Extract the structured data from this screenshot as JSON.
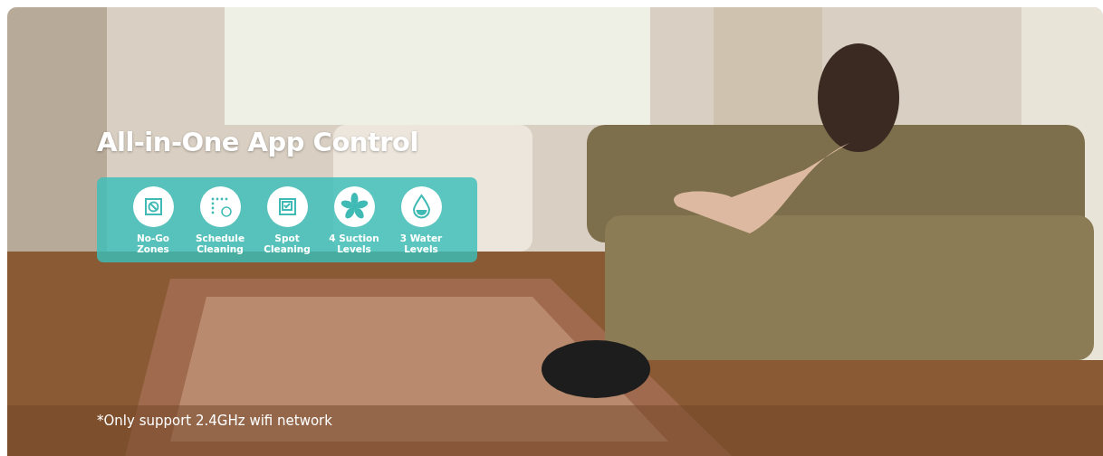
{
  "banner": {
    "kind": "picture",
    "title": "All-in-One App Control",
    "features": [
      {
        "kind": "zone",
        "label": "No-Go Zones"
      },
      {
        "kind": "schedule",
        "label": "Schedule Cleaning"
      },
      {
        "kind": "spot",
        "label": "Spot Cleaning"
      },
      {
        "kind": "suction",
        "label": "4 Suction Levels"
      },
      {
        "kind": "water",
        "label": "3 Water Levels"
      }
    ],
    "footnote": "*Only support 2.4GHz wifi network"
  }
}
